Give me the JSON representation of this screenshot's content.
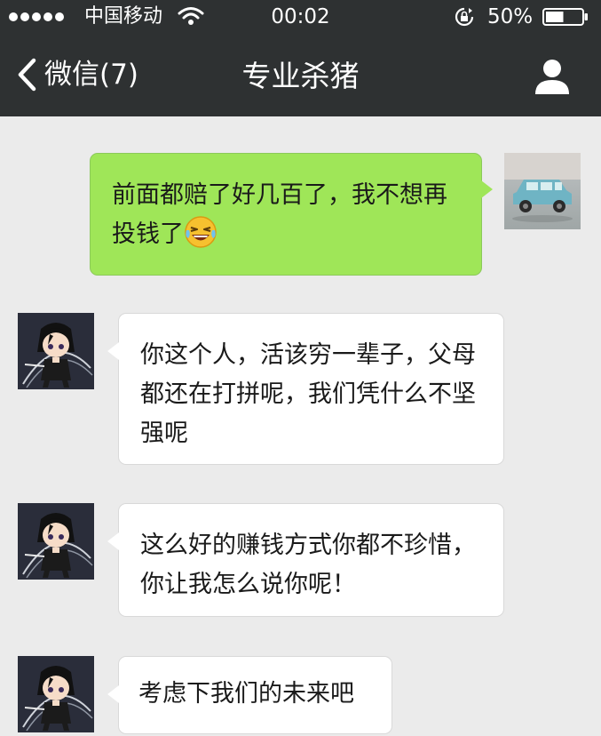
{
  "status_bar": {
    "carrier": "中国移动",
    "time": "00:02",
    "battery_percent": "50%",
    "battery_level": 0.5
  },
  "nav": {
    "back_label": "微信(7)",
    "title": "专业杀猪",
    "icons": {
      "back": "chevron-left-icon",
      "profile": "person-icon"
    }
  },
  "messages": [
    {
      "side": "outgoing",
      "text": "前面都赔了好几百了，我不想再投钱了",
      "emoji": "laughing-crying-emoji",
      "avatar": "car-photo-avatar"
    },
    {
      "side": "incoming",
      "text": "你这个人，活该穷一辈子，父母都还在打拼呢，我们凭什么不坚强呢",
      "avatar": "anime-character-avatar"
    },
    {
      "side": "incoming",
      "text": "这么好的赚钱方式你都不珍惜，你让我怎么说你呢！",
      "avatar": "anime-character-avatar"
    },
    {
      "side": "incoming",
      "text": "考虑下我们的未来吧",
      "avatar": "anime-character-avatar"
    }
  ],
  "colors": {
    "bar_background": "#2e3132",
    "chat_background": "#ebebeb",
    "outgoing_bubble": "#9fe658",
    "incoming_bubble": "#ffffff"
  }
}
